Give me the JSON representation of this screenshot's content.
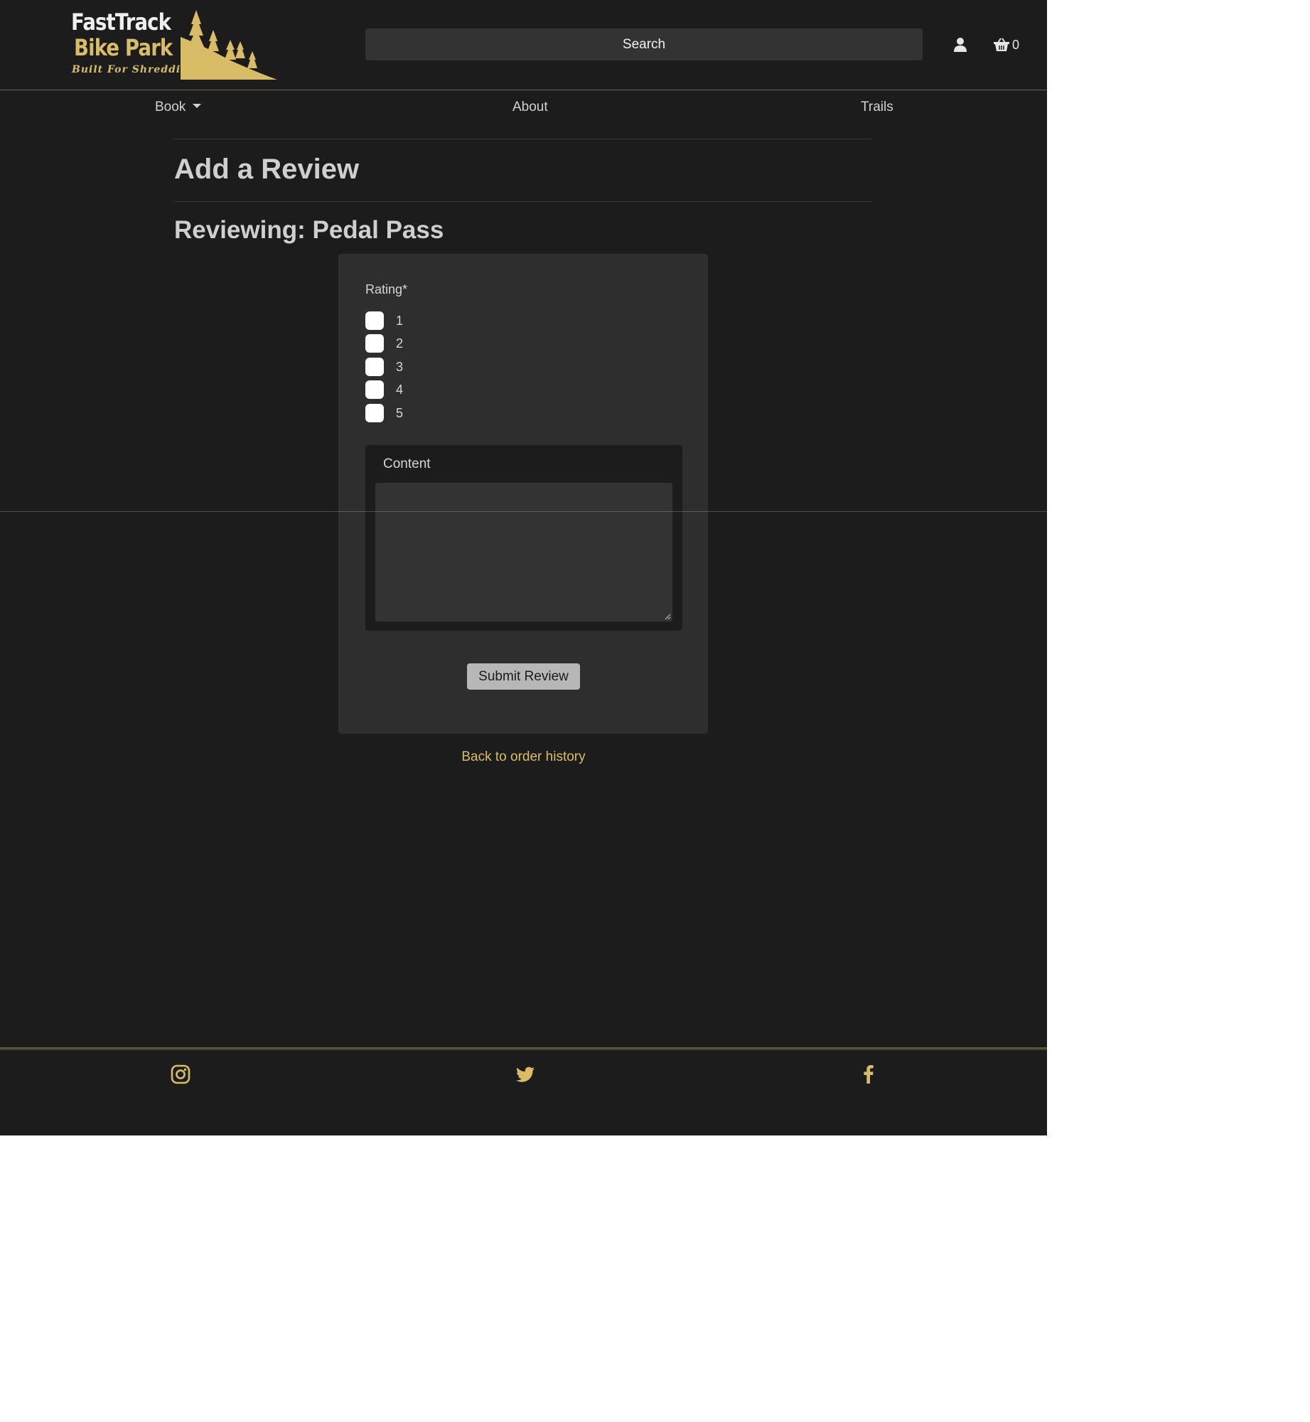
{
  "header": {
    "logo": {
      "line1": "FastTrack",
      "line2": "Bike Park",
      "tagline": "Built For Shredding"
    },
    "search_placeholder": "Search",
    "cart_count": "0",
    "icons": {
      "user": "user-icon",
      "cart": "basket-icon"
    }
  },
  "nav": {
    "items": [
      {
        "label": "Book",
        "dropdown": true
      },
      {
        "label": "About"
      },
      {
        "label": "Trails"
      }
    ]
  },
  "main": {
    "title": "Add a Review",
    "subtitle": "Reviewing: Pedal Pass",
    "form": {
      "rating_label": "Rating*",
      "rating_options": [
        "1",
        "2",
        "3",
        "4",
        "5"
      ],
      "content_label": "Content",
      "content_value": "",
      "submit_label": "Submit Review"
    },
    "back_link": "Back to order history"
  },
  "footer": {
    "social": [
      "instagram-icon",
      "twitter-icon",
      "facebook-icon"
    ]
  },
  "colors": {
    "background": "#1c1c1c",
    "accent": "#d8bd66",
    "card": "#2e2e2e",
    "text": "#d6d6d6"
  }
}
